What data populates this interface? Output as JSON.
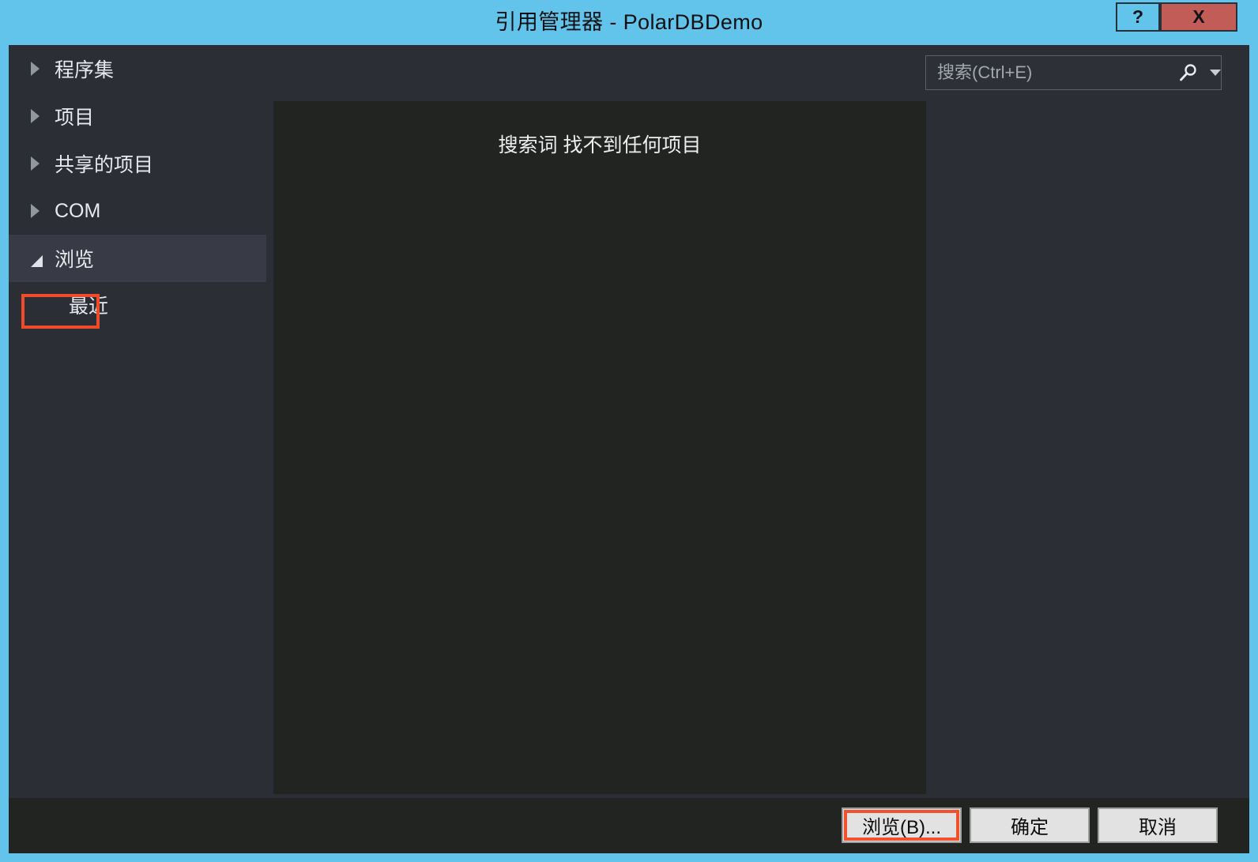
{
  "window": {
    "title": "引用管理器 - PolarDBDemo",
    "titlebar_color": "#62c4ea",
    "close_button_color": "#c15c57",
    "highlight_color": "#ef4b2a"
  },
  "controls": {
    "help_label": "?",
    "close_label": "X"
  },
  "search": {
    "placeholder": "搜索(Ctrl+E)",
    "value": "",
    "icon": "search-icon",
    "dropdown_icon": "chevron-down-icon"
  },
  "sidebar": {
    "items": [
      {
        "label": "程序集",
        "expanded": false,
        "selected": false,
        "level": 0
      },
      {
        "label": "项目",
        "expanded": false,
        "selected": false,
        "level": 0
      },
      {
        "label": "共享的项目",
        "expanded": false,
        "selected": false,
        "level": 0
      },
      {
        "label": "COM",
        "expanded": false,
        "selected": false,
        "level": 0
      },
      {
        "label": "浏览",
        "expanded": true,
        "selected": true,
        "level": 0
      },
      {
        "label": "最近",
        "expanded": false,
        "selected": false,
        "level": 1
      }
    ]
  },
  "results": {
    "empty_message": "搜索词  找不到任何项目"
  },
  "footer": {
    "browse_label": "浏览(B)...",
    "ok_label": "确定",
    "cancel_label": "取消"
  }
}
